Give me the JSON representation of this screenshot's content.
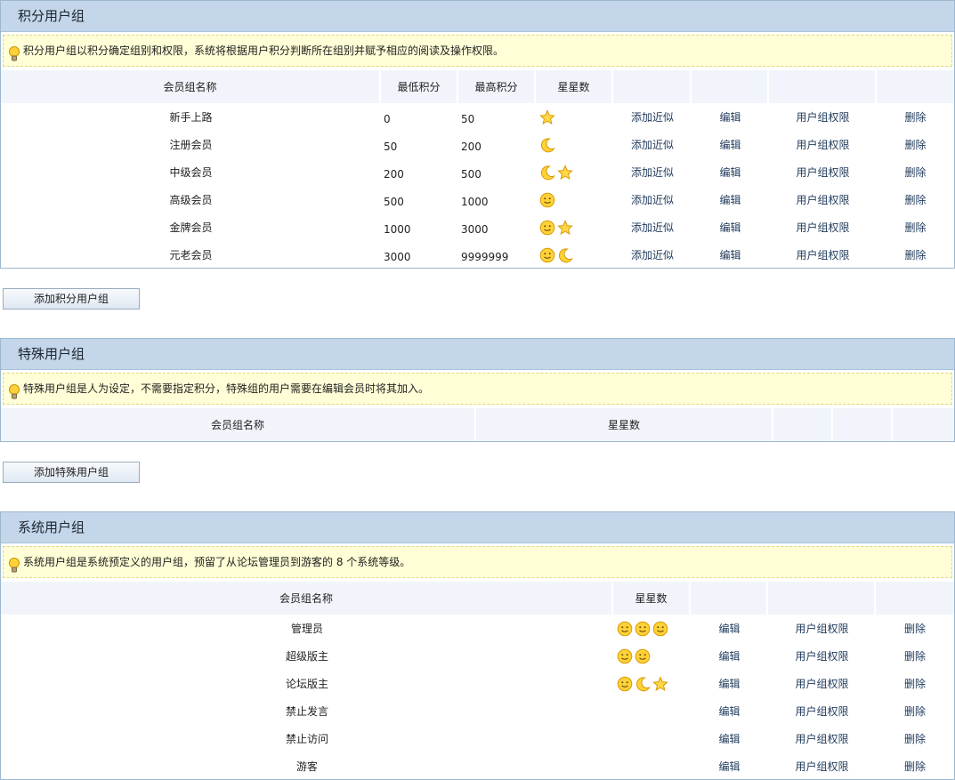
{
  "credit_panel": {
    "title": "积分用户组",
    "tip": "积分用户组以积分确定组别和权限，系统将根据用户积分判断所在组别并赋予相应的阅读及操作权限。",
    "headers": {
      "name": "会员组名称",
      "min": "最低积分",
      "max": "最高积分",
      "stars": "星星数"
    },
    "rows": [
      {
        "name": "新手上路",
        "min": "0",
        "max": "50",
        "stars": [
          "star"
        ]
      },
      {
        "name": "注册会员",
        "min": "50",
        "max": "200",
        "stars": [
          "moon"
        ]
      },
      {
        "name": "中级会员",
        "min": "200",
        "max": "500",
        "stars": [
          "moon",
          "star"
        ]
      },
      {
        "name": "高级会员",
        "min": "500",
        "max": "1000",
        "stars": [
          "sun"
        ]
      },
      {
        "name": "金牌会员",
        "min": "1000",
        "max": "3000",
        "stars": [
          "sun",
          "star"
        ]
      },
      {
        "name": "元老会员",
        "min": "3000",
        "max": "9999999",
        "stars": [
          "sun",
          "moon"
        ]
      }
    ]
  },
  "actions": {
    "copy": "添加近似",
    "edit": "编辑",
    "perms": "用户组权限",
    "delete": "删除"
  },
  "add_credit_button": "添加积分用户组",
  "special_panel": {
    "title": "特殊用户组",
    "tip": "特殊用户组是人为设定，不需要指定积分，特殊组的用户需要在编辑会员时将其加入。",
    "headers": {
      "name": "会员组名称",
      "stars": "星星数"
    }
  },
  "add_special_button": "添加特殊用户组",
  "system_panel": {
    "title": "系统用户组",
    "tip": "系统用户组是系统预定义的用户组，预留了从论坛管理员到游客的 8 个系统等级。",
    "headers": {
      "name": "会员组名称",
      "stars": "星星数"
    },
    "rows": [
      {
        "name": "管理员",
        "stars": [
          "sun",
          "sun",
          "sun"
        ]
      },
      {
        "name": "超级版主",
        "stars": [
          "sun",
          "sun"
        ]
      },
      {
        "name": "论坛版主",
        "stars": [
          "sun",
          "moon",
          "star"
        ]
      },
      {
        "name": "禁止发言",
        "stars": []
      },
      {
        "name": "禁止访问",
        "stars": []
      },
      {
        "name": "游客",
        "stars": []
      }
    ]
  },
  "colors": {
    "header_bar": "#c3d6ea",
    "tip_bg": "#fffed6",
    "border": "#9db7cf",
    "icon_gold": "#f2b90f"
  }
}
